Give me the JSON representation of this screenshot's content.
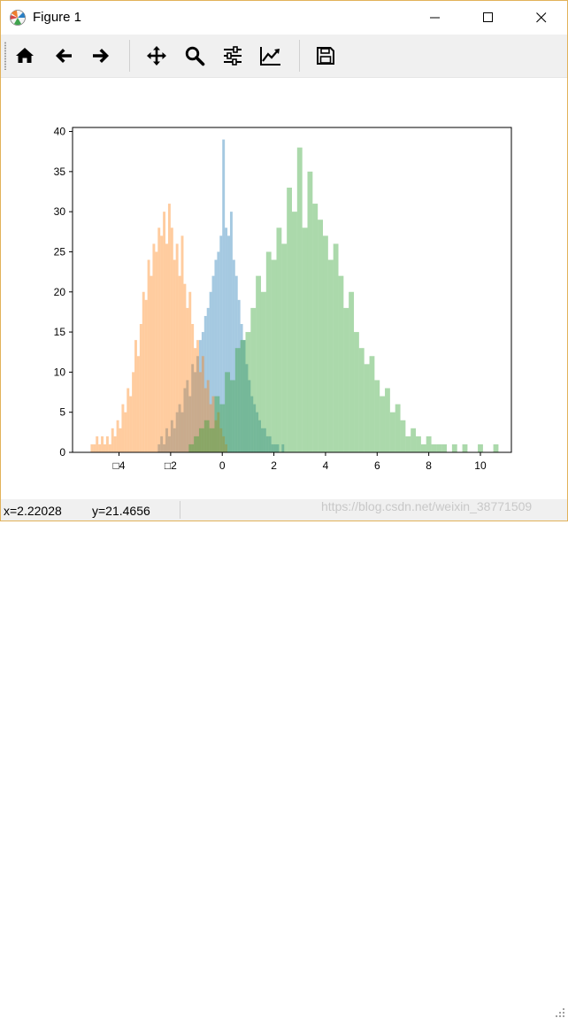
{
  "window": {
    "title": "Figure 1"
  },
  "toolbar": {
    "items": [
      {
        "name": "home-icon"
      },
      {
        "name": "back-arrow-icon"
      },
      {
        "name": "forward-arrow-icon"
      },
      {
        "name": "pan-move-icon"
      },
      {
        "name": "zoom-magnifier-icon"
      },
      {
        "name": "configure-subplots-icon"
      },
      {
        "name": "edit-axis-icon"
      },
      {
        "name": "save-floppy-icon"
      }
    ]
  },
  "status": {
    "x_readout": "x=2.22028",
    "y_readout": "y=21.4656"
  },
  "watermark": "https://blog.csdn.net/weixin_38771509",
  "colors": {
    "series_blue": "#1f77b4",
    "series_orange": "#ff7f0e",
    "series_green": "#2ca02c",
    "window_border": "#e2b25a",
    "toolbar_bg": "#f0f0f0"
  },
  "chart_data": {
    "type": "bar",
    "title": "",
    "xlabel": "",
    "ylabel": "",
    "xlim": [
      -5.8,
      11.2
    ],
    "ylim": [
      0,
      40.5
    ],
    "xticks": [
      -4,
      -2,
      0,
      2,
      4,
      6,
      8,
      10
    ],
    "xtick_labels": [
      "□4",
      "□2",
      "0",
      "2",
      "4",
      "6",
      "8",
      "10"
    ],
    "yticks": [
      0,
      5,
      10,
      15,
      20,
      25,
      30,
      35,
      40
    ],
    "ytick_labels": [
      "0",
      "5",
      "10",
      "15",
      "20",
      "25",
      "30",
      "35",
      "40"
    ],
    "grid": false,
    "alpha": 0.4,
    "series": [
      {
        "color": "#1f77b4",
        "bins": [
          -2.5,
          -2.4,
          -2.3,
          -2.2,
          -2.1,
          -2.0,
          -1.9,
          -1.8,
          -1.7,
          -1.6,
          -1.5,
          -1.4,
          -1.3,
          -1.2,
          -1.1,
          -1.0,
          -0.9,
          -0.8,
          -0.7,
          -0.6,
          -0.5,
          -0.4,
          -0.3,
          -0.2,
          -0.1,
          0.0,
          0.1,
          0.2,
          0.3,
          0.4,
          0.5,
          0.6,
          0.7,
          0.8,
          0.9,
          1.0,
          1.1,
          1.2,
          1.3,
          1.4,
          1.5,
          1.6,
          1.7,
          1.8,
          1.9,
          2.0,
          2.1,
          2.2,
          2.3,
          2.4,
          2.5,
          2.6
        ],
        "values": [
          1,
          2,
          1,
          3,
          2,
          4,
          3,
          5,
          6,
          5,
          8,
          9,
          7,
          11,
          10,
          12,
          14,
          15,
          17,
          18,
          20,
          22,
          24,
          25,
          27,
          39,
          28,
          27,
          30,
          24,
          22,
          19,
          16,
          14,
          11,
          9,
          7,
          6,
          5,
          4,
          3,
          3,
          2,
          2,
          1,
          1,
          1,
          0,
          1,
          0,
          0
        ]
      },
      {
        "color": "#ff7f0e",
        "bins": [
          -5.1,
          -5.0,
          -4.9,
          -4.8,
          -4.7,
          -4.6,
          -4.5,
          -4.4,
          -4.3,
          -4.2,
          -4.1,
          -4.0,
          -3.9,
          -3.8,
          -3.7,
          -3.6,
          -3.5,
          -3.4,
          -3.3,
          -3.2,
          -3.1,
          -3.0,
          -2.9,
          -2.8,
          -2.7,
          -2.6,
          -2.5,
          -2.4,
          -2.3,
          -2.2,
          -2.1,
          -2.0,
          -1.9,
          -1.8,
          -1.7,
          -1.6,
          -1.5,
          -1.4,
          -1.3,
          -1.2,
          -1.1,
          -1.0,
          -0.9,
          -0.8,
          -0.7,
          -0.6,
          -0.5,
          -0.4,
          -0.3,
          -0.2,
          -0.1,
          0.0,
          0.1,
          0.2
        ],
        "values": [
          1,
          1,
          2,
          1,
          2,
          1,
          2,
          1,
          3,
          2,
          4,
          3,
          6,
          5,
          8,
          7,
          10,
          14,
          12,
          16,
          20,
          19,
          24,
          22,
          26,
          25,
          28,
          27,
          30,
          26,
          31,
          28,
          24,
          26,
          22,
          27,
          21,
          18,
          20,
          16,
          13,
          14,
          10,
          12,
          8,
          9,
          6,
          7,
          4,
          5,
          3,
          2,
          1
        ]
      },
      {
        "color": "#2ca02c",
        "bins": [
          -1.3,
          -1.1,
          -0.9,
          -0.7,
          -0.5,
          -0.3,
          -0.1,
          0.1,
          0.3,
          0.5,
          0.7,
          0.9,
          1.1,
          1.3,
          1.5,
          1.7,
          1.9,
          2.1,
          2.3,
          2.5,
          2.7,
          2.9,
          3.1,
          3.3,
          3.5,
          3.7,
          3.9,
          4.1,
          4.3,
          4.5,
          4.7,
          4.9,
          5.1,
          5.3,
          5.5,
          5.7,
          5.9,
          6.1,
          6.3,
          6.5,
          6.7,
          6.9,
          7.1,
          7.3,
          7.5,
          7.7,
          7.9,
          8.1,
          8.3,
          8.5,
          8.7,
          8.9,
          9.1,
          9.3,
          9.5,
          9.7,
          9.9,
          10.1,
          10.3,
          10.5,
          10.7
        ],
        "values": [
          1,
          2,
          3,
          4,
          3,
          7,
          6,
          10,
          9,
          13,
          14,
          15,
          18,
          22,
          20,
          25,
          24,
          28,
          26,
          33,
          30,
          38,
          28,
          35,
          31,
          29,
          27,
          24,
          26,
          22,
          18,
          20,
          15,
          13,
          11,
          12,
          9,
          7,
          8,
          5,
          6,
          4,
          2,
          3,
          2,
          1,
          2,
          1,
          1,
          1,
          0,
          1,
          0,
          1,
          0,
          0,
          1,
          0,
          0,
          1
        ]
      }
    ]
  }
}
